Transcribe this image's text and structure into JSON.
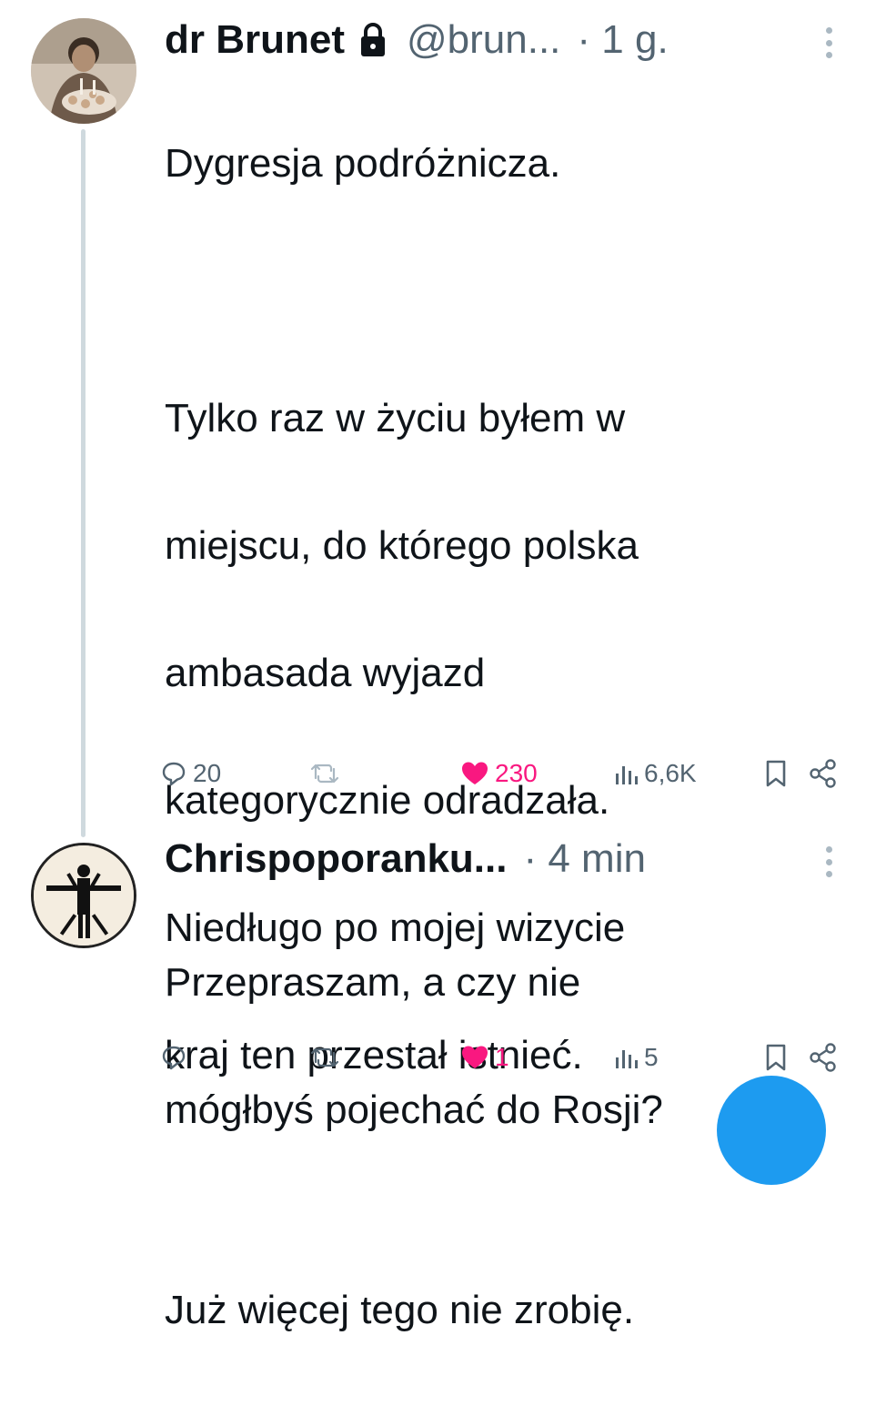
{
  "tweets": [
    {
      "author_name": "dr Brunet",
      "protected": true,
      "handle": "@brun...",
      "time": "· 1 g.",
      "lines": [
        "Dygresja podróżnicza.",
        "",
        "Tylko raz w życiu byłem w",
        "miejscu, do którego polska",
        "ambasada wyjazd",
        "kategorycznie odradzała.",
        "Niedługo po mojej wizycie",
        "kraj ten przestał istnieć.",
        "",
        "Już więcej tego nie zrobię."
      ],
      "actions": {
        "replies": "20",
        "reposts": "",
        "likes": "230",
        "views": "6,6K",
        "liked": true
      }
    },
    {
      "author_name": "Chrispoporanku...",
      "protected": false,
      "handle": "",
      "time": "· 4 min",
      "lines": [
        "Przepraszam, a czy nie",
        "mógłbyś pojechać do Rosji?"
      ],
      "actions": {
        "replies": "",
        "reposts": "",
        "likes": "1",
        "views": "5",
        "liked": true
      }
    }
  ],
  "colors": {
    "text": "#0f1419",
    "secondary": "#536471",
    "like": "#f91880",
    "thread_line": "#cfd9de",
    "fab": "#1d9bf0"
  },
  "icons": [
    "lock-icon",
    "more-icon",
    "reply-icon",
    "repost-icon",
    "heart-icon",
    "views-icon",
    "bookmark-icon",
    "share-icon"
  ]
}
